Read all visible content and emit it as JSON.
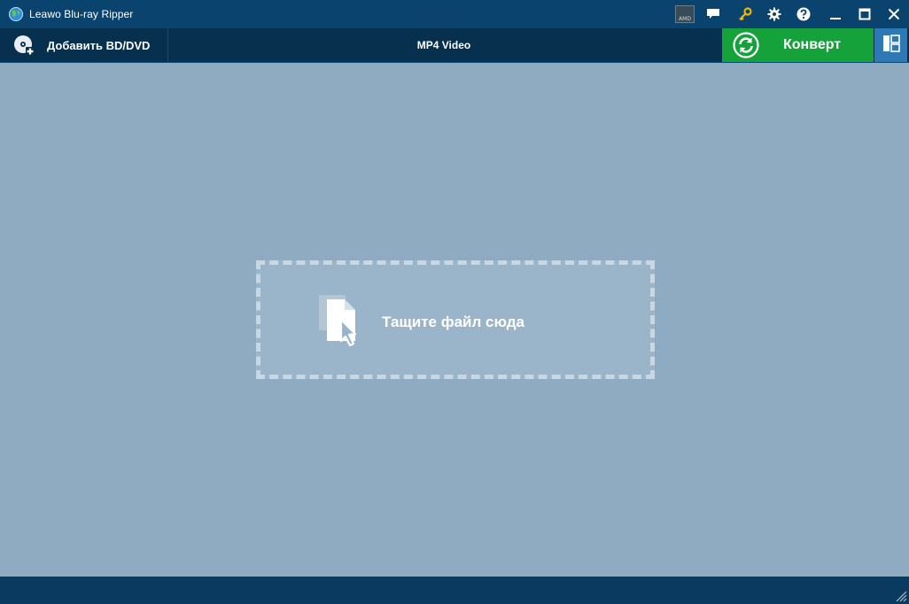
{
  "window": {
    "title": "Leawo Blu-ray Ripper",
    "icon": "leawo-globe-icon"
  },
  "titlebar": {
    "amd_badge": "AMD",
    "icons": [
      "amd-badge-icon",
      "chat-icon",
      "key-icon",
      "gear-icon",
      "help-icon",
      "minimize-icon",
      "maximize-icon",
      "close-icon"
    ]
  },
  "toolbar": {
    "add_label": "Добавить BD/DVD",
    "profile_label": "MP4 Video",
    "convert_label": "Конверт"
  },
  "main": {
    "drop_label": "Тащите файл сюда"
  },
  "colors": {
    "titlebar": "#0a436e",
    "toolbar": "#072f4e",
    "convert": "#16a23a",
    "layout_button": "#2c79b6",
    "workspace": "#8eabc2",
    "dropzone": "#9ab5ca"
  }
}
